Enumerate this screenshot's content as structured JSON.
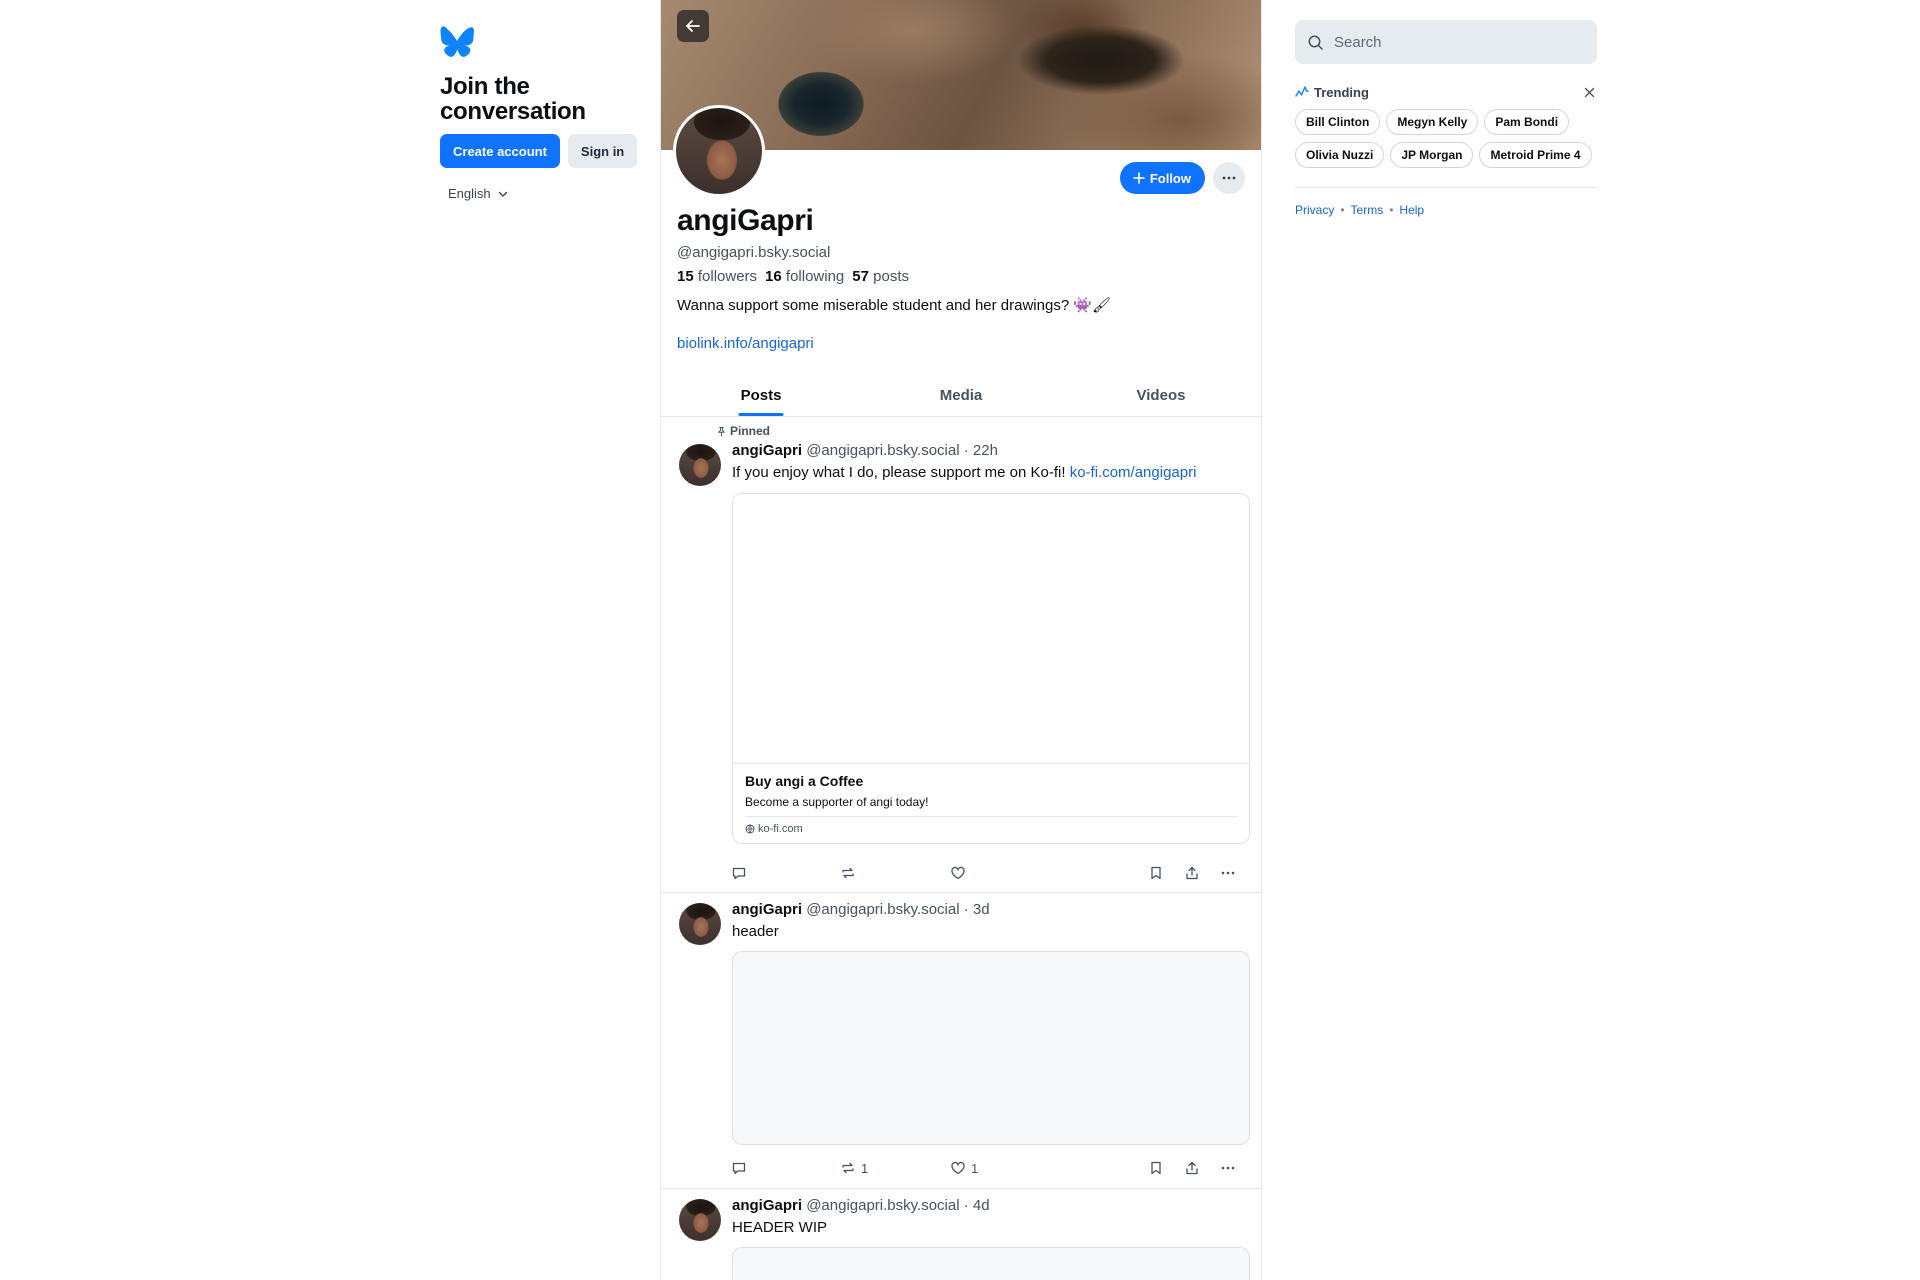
{
  "brand": {
    "accent": "#0f73ff",
    "link": "#1566d6"
  },
  "left": {
    "join_title": "Join the conversation",
    "create_account": "Create account",
    "sign_in": "Sign in",
    "language": "English"
  },
  "profile": {
    "display_name": "angiGapri",
    "handle": "@angigapri.bsky.social",
    "followers_count": "15",
    "followers_label": "followers",
    "following_count": "16",
    "following_label": "following",
    "posts_count": "57",
    "posts_label": "posts",
    "bio": "Wanna support some miserable student and her drawings? 👾🖌",
    "link": "biolink.info/angigapri",
    "follow_label": "Follow"
  },
  "tabs": [
    {
      "label": "Posts",
      "active": true
    },
    {
      "label": "Media",
      "active": false
    },
    {
      "label": "Videos",
      "active": false
    }
  ],
  "posts": [
    {
      "pinned_label": "Pinned",
      "author": "angiGapri",
      "handle": "@angigapri.bsky.social",
      "time": "22h",
      "text": "If you enjoy what I do, please support me on Ko-fi!",
      "link_text": "ko-fi.com/angigapri",
      "embed": {
        "title": "Buy angi a Coffee",
        "description": "Become a supporter of angi today!",
        "domain": "ko-fi.com"
      },
      "reposts": "",
      "likes": ""
    },
    {
      "author": "angiGapri",
      "handle": "@angigapri.bsky.social",
      "time": "3d",
      "text": "header",
      "reposts": "1",
      "likes": "1"
    },
    {
      "author": "angiGapri",
      "handle": "@angigapri.bsky.social",
      "time": "4d",
      "text": "HEADER WIP"
    }
  ],
  "right": {
    "search_placeholder": "Search",
    "trending_title": "Trending",
    "trending": [
      "Bill Clinton",
      "Megyn Kelly",
      "Pam Bondi",
      "Olivia Nuzzi",
      "JP Morgan",
      "Metroid Prime 4"
    ],
    "footer": [
      "Privacy",
      "Terms",
      "Help"
    ]
  },
  "icons": {
    "logo": "butterfly-logo-icon",
    "back": "arrow-left-icon",
    "follow": "plus-icon",
    "more": "ellipsis-icon",
    "pinned": "pin-icon",
    "reply": "speech-bubble-icon",
    "repost": "repost-icon",
    "like": "heart-icon",
    "bookmark": "bookmark-icon",
    "share": "share-icon",
    "search": "search-icon",
    "trending": "trending-icon",
    "close": "close-icon",
    "domain": "globe-icon",
    "language": "chevron-down-icon"
  }
}
